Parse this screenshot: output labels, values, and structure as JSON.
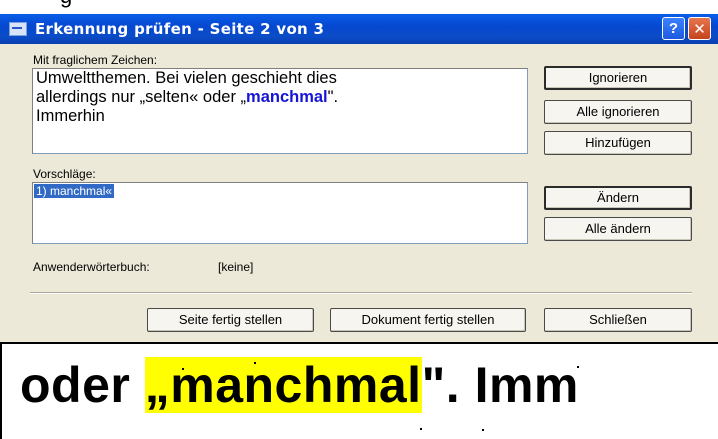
{
  "window": {
    "title": "Erkennung prüfen - Seite 2 von 3",
    "help_label": "?",
    "close_label": "✕"
  },
  "fragment": "g",
  "context": {
    "label": "Mit fraglichem Zeichen:",
    "line1": "Umweltthemen. Bei vielen geschieht dies",
    "line2_before": "allerdings nur „selten« oder „",
    "line2_word": "manchmal",
    "line2_after": "\".",
    "line3": "Immerhin"
  },
  "suggestions": {
    "label": "Vorschläge:",
    "items": [
      "1) manchmal«"
    ]
  },
  "dictionary": {
    "label": "Anwenderwörterbuch:",
    "value": "[keine]"
  },
  "buttons": {
    "ignore": "Ignorieren",
    "ignore_all": "Alle ignorieren",
    "add": "Hinzufügen",
    "change": "Ändern",
    "change_all": "Alle ändern",
    "finish_page": "Seite fertig stellen",
    "finish_document": "Dokument fertig stellen",
    "close": "Schließen"
  },
  "zoom": {
    "before": "oder ",
    "highlight": "„manchmal",
    "after": "\". Imm"
  },
  "colors": {
    "titlebar": "#0548d0",
    "dialog_bg": "#ece9d8",
    "highlight_word": "#1515d8",
    "selection": "#316ac5",
    "zoom_highlight": "#ffff00"
  }
}
